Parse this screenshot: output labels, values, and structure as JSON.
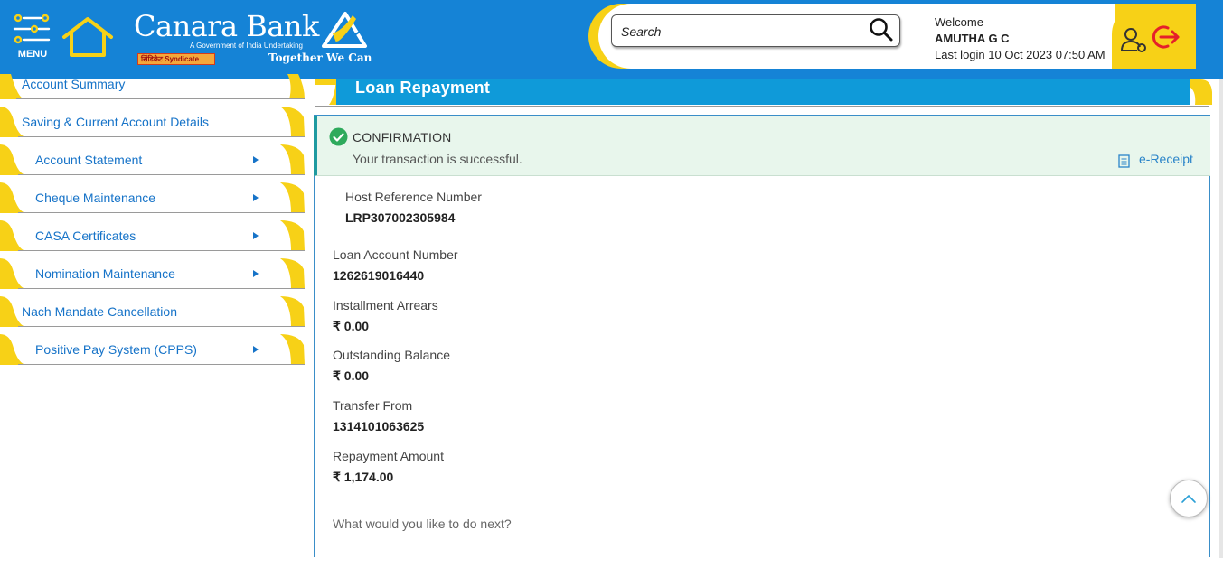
{
  "header": {
    "menu_label": "MENU",
    "logo": {
      "name": "Canara Bank",
      "subtitle": "A Government of India Undertaking",
      "syndicate": "सिंडिकेट Syndicate",
      "tagline": "Together We Can"
    },
    "search": {
      "placeholder": "Search",
      "value": ""
    },
    "welcome": {
      "greeting": "Welcome",
      "user_name": "AMUTHA G C",
      "last_login": "Last login 10 Oct 2023 07:50 AM"
    },
    "icons": [
      "menu-icon",
      "home-icon",
      "search-icon",
      "profile-icon",
      "logout-icon"
    ],
    "colors": {
      "primary_blue": "#1583d6",
      "accent_yellow": "#f7d117",
      "logout_red": "#e5202a"
    }
  },
  "sidebar": {
    "items": [
      {
        "label": "Account Summary",
        "has_arrow": false
      },
      {
        "label": "Saving & Current Account Details",
        "has_arrow": false
      },
      {
        "label": "Account Statement",
        "has_arrow": true
      },
      {
        "label": "Cheque Maintenance",
        "has_arrow": true
      },
      {
        "label": "CASA Certificates",
        "has_arrow": true
      },
      {
        "label": "Nomination Maintenance",
        "has_arrow": true
      },
      {
        "label": "Nach Mandate Cancellation",
        "has_arrow": false
      },
      {
        "label": "Positive Pay System (CPPS)",
        "has_arrow": true
      }
    ]
  },
  "main": {
    "title": "Loan Repayment",
    "confirmation": {
      "title": "CONFIRMATION",
      "message": "Your transaction is successful.",
      "ereceipt_label": "e-Receipt",
      "status_color": "#2eaa5c"
    },
    "host_reference": {
      "label": "Host Reference Number",
      "value": "LRP307002305984"
    },
    "fields": [
      {
        "label": "Loan Account Number",
        "value": "1262619016440"
      },
      {
        "label": "Installment Arrears",
        "value": "₹ 0.00"
      },
      {
        "label": "Outstanding Balance",
        "value": "₹ 0.00"
      },
      {
        "label": "Transfer From",
        "value": "1314101063625"
      },
      {
        "label": "Repayment Amount",
        "value": "₹ 1,174.00"
      }
    ],
    "next_prompt": "What would you like to do next?"
  }
}
